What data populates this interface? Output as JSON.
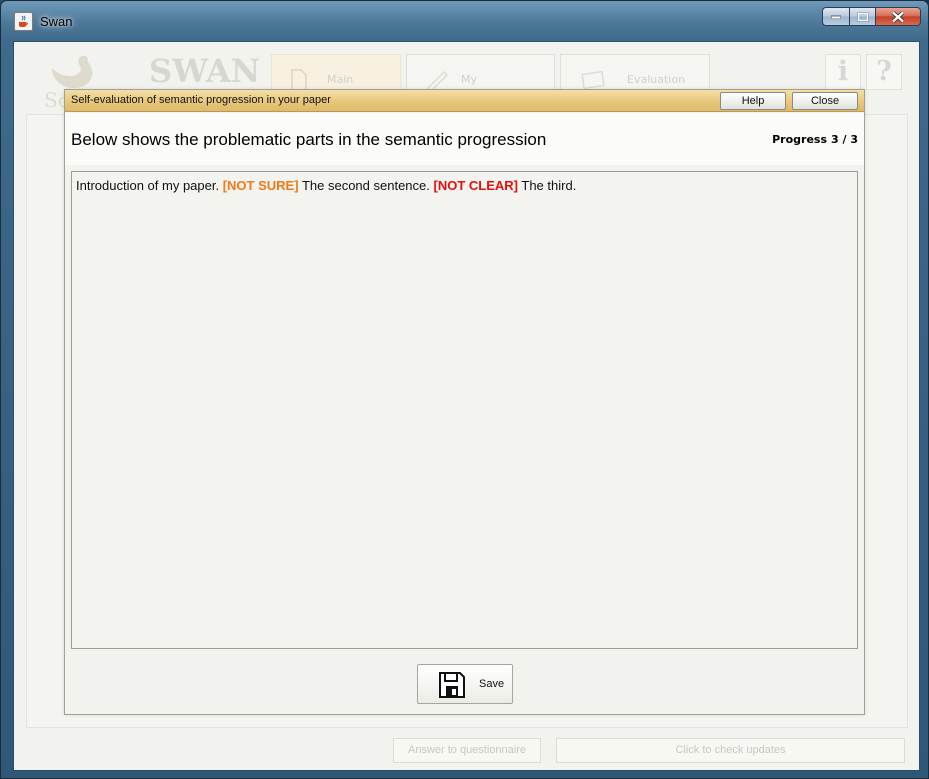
{
  "window": {
    "title": "Swan",
    "icon": "java-cup-icon"
  },
  "background_app": {
    "logo_text": "SWAN",
    "logo_subtext": "Sci",
    "tabs": [
      {
        "label": "Main",
        "icon": "document-icon"
      },
      {
        "label": "My",
        "icon": "pen-icon"
      },
      {
        "label": "Evaluation",
        "icon": "cards-icon"
      }
    ],
    "info_glyph": "i",
    "help_glyph": "?",
    "questionnaire_button": "Answer to questionnaire",
    "updates_button": "Click to check updates"
  },
  "dialog": {
    "title": "Self-evaluation of semantic progression in your paper",
    "help_button": "Help",
    "close_button": "Close",
    "heading": "Below shows the problematic parts in the semantic progression",
    "progress_label": "Progress",
    "progress_value": "3 / 3",
    "text": {
      "part1": "Introduction of my paper.",
      "flag1": "[NOT SURE]",
      "part2": "The second sentence.",
      "flag2": "[NOT CLEAR]",
      "part3": "The third."
    },
    "save_button": "Save",
    "colors": {
      "title_bar": "#e8c77b",
      "flag_not_sure": "#f07a14",
      "flag_not_clear": "#e2110e"
    }
  }
}
